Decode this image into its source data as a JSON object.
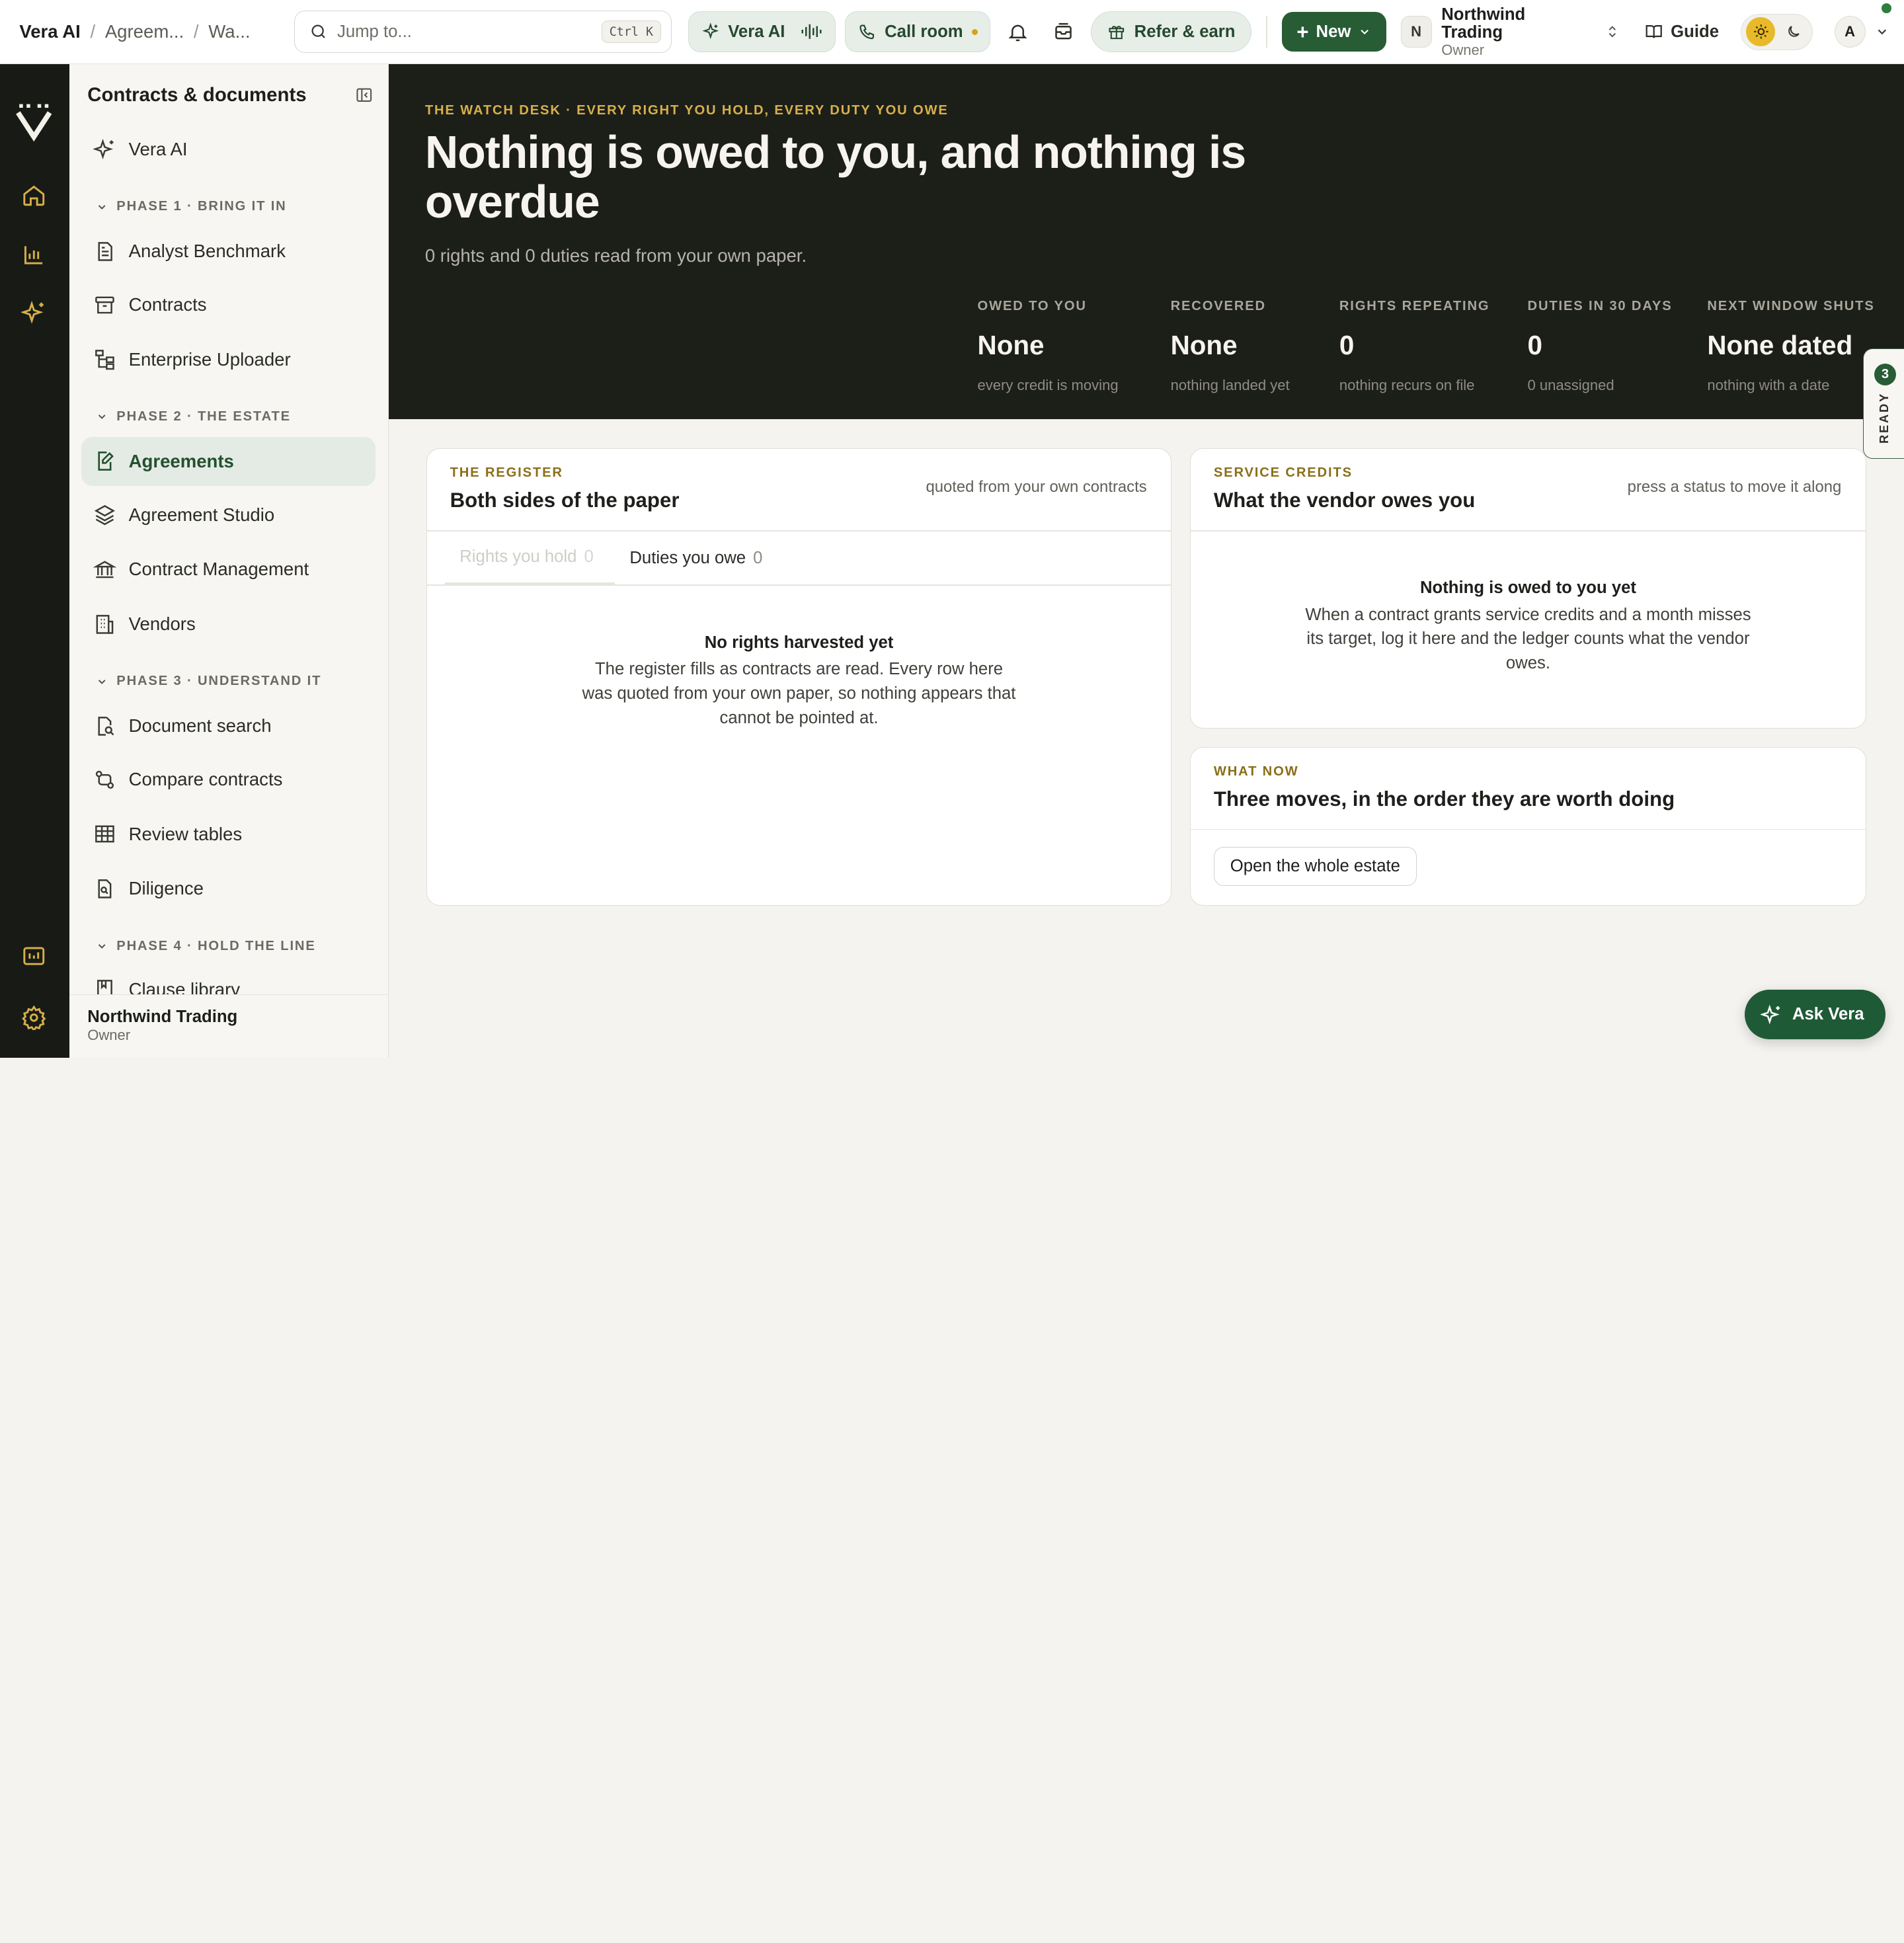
{
  "breadcrumb": [
    "Vera AI",
    "Agreem...",
    "Wa..."
  ],
  "search": {
    "placeholder": "Jump to...",
    "shortcut": "Ctrl K"
  },
  "topbar": {
    "vera_label": "Vera AI",
    "call_label": "Call room",
    "refer_label": "Refer & earn",
    "new_label": "New",
    "org_initial": "N",
    "org_name": "Northwind Trading",
    "org_role": "Owner",
    "guide_label": "Guide",
    "user_initial": "A"
  },
  "sidebar": {
    "title": "Contracts & documents",
    "top_item": "Vera AI",
    "phases": [
      {
        "label": "PHASE 1 · BRING IT IN",
        "items": [
          "Analyst Benchmark",
          "Contracts",
          "Enterprise Uploader"
        ]
      },
      {
        "label": "PHASE 2 · THE ESTATE",
        "items": [
          "Agreements",
          "Agreement Studio",
          "Contract Management",
          "Vendors"
        ]
      },
      {
        "label": "PHASE 3 · UNDERSTAND IT",
        "items": [
          "Document search",
          "Compare contracts",
          "Review tables",
          "Diligence"
        ]
      },
      {
        "label": "PHASE 4 · HOLD THE LINE",
        "items": [
          "Clause library"
        ]
      }
    ],
    "active_item": "Agreements",
    "footer": {
      "name": "Northwind Trading",
      "role": "Owner"
    }
  },
  "hero": {
    "eyebrow": "THE WATCH DESK · EVERY RIGHT YOU HOLD, EVERY DUTY YOU OWE",
    "title": "Nothing is owed to you, and nothing is overdue",
    "subtitle": "0 rights and 0 duties read from your own paper.",
    "stats": [
      {
        "label": "OWED TO YOU",
        "value": "None",
        "note": "every credit is moving"
      },
      {
        "label": "RECOVERED",
        "value": "None",
        "note": "nothing landed yet"
      },
      {
        "label": "RIGHTS REPEATING",
        "value": "0",
        "note": "nothing recurs on file"
      },
      {
        "label": "DUTIES IN 30 DAYS",
        "value": "0",
        "note": "0 unassigned"
      },
      {
        "label": "NEXT WINDOW SHUTS",
        "value": "None dated",
        "note": "nothing with a date"
      }
    ]
  },
  "ready_tab": {
    "count": "3",
    "label": "READY"
  },
  "register": {
    "eyebrow": "THE REGISTER",
    "title": "Both sides of the paper",
    "hint": "quoted from your own contracts",
    "tabs": [
      {
        "label": "Rights you hold",
        "count": "0"
      },
      {
        "label": "Duties you owe",
        "count": "0"
      }
    ],
    "empty_title": "No rights harvested yet",
    "empty_text": "The register fills as contracts are read. Every row here was quoted from your own paper, so nothing appears that cannot be pointed at."
  },
  "credits": {
    "eyebrow": "SERVICE CREDITS",
    "title": "What the vendor owes you",
    "hint": "press a status to move it along",
    "empty_title": "Nothing is owed to you yet",
    "empty_text": "When a contract grants service credits and a month misses its target, log it here and the ledger counts what the vendor owes."
  },
  "whatnow": {
    "eyebrow": "WHAT NOW",
    "title": "Three moves, in the order they are worth doing",
    "button": "Open the whole estate"
  },
  "ask_vera": "Ask Vera",
  "colors": {
    "brand": "#275c35",
    "hero_bg": "#1c1e18",
    "accent_gold": "#d7b04a",
    "rail_bg": "#181b15"
  }
}
